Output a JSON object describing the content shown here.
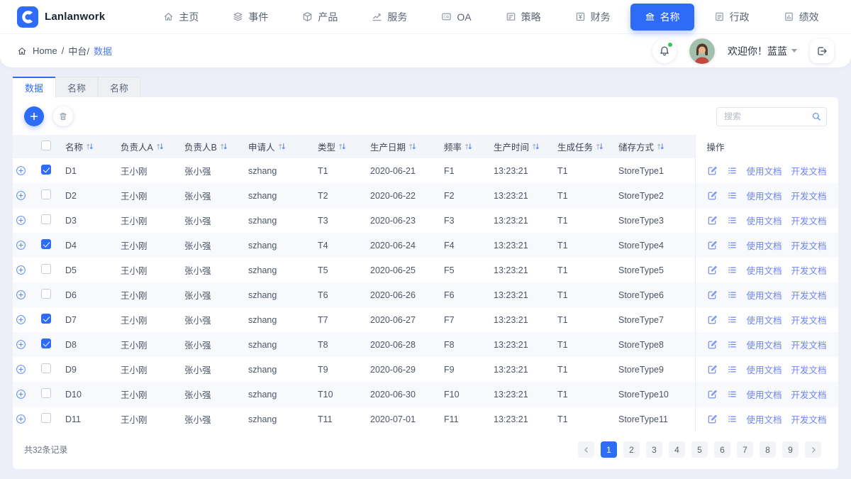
{
  "brand": {
    "name": "Lanlanwork",
    "logo_icon": "brand-c-icon",
    "logo_color": "#2e6bf6"
  },
  "nav": {
    "items": [
      {
        "label": "主页",
        "icon": "home-icon",
        "active": false
      },
      {
        "label": "事件",
        "icon": "event-icon",
        "active": false
      },
      {
        "label": "产品",
        "icon": "product-icon",
        "active": false
      },
      {
        "label": "服务",
        "icon": "service-icon",
        "active": false
      },
      {
        "label": "OA",
        "icon": "oa-icon",
        "active": false
      },
      {
        "label": "策略",
        "icon": "strategy-icon",
        "active": false
      },
      {
        "label": "财务",
        "icon": "finance-icon",
        "active": false
      },
      {
        "label": "名称",
        "icon": "bank-icon",
        "active": true
      },
      {
        "label": "行政",
        "icon": "admin-icon",
        "active": false
      },
      {
        "label": "绩效",
        "icon": "performance-icon",
        "active": false
      }
    ],
    "active_color": "#2e6bf6"
  },
  "breadcrumb": {
    "home": "Home",
    "sep": "/",
    "section": "中台/",
    "current": "数据"
  },
  "userbar": {
    "welcome": "欢迎你！蓝蓝",
    "bell_icon": "bell-icon",
    "logout_icon": "logout-icon",
    "notification_dot_color": "#35c759"
  },
  "tabs": [
    {
      "label": "数据",
      "active": true
    },
    {
      "label": "名称",
      "active": false
    },
    {
      "label": "名称",
      "active": false
    }
  ],
  "toolbar": {
    "add_icon": "plus-icon",
    "delete_icon": "trash-icon",
    "search_placeholder": "搜索",
    "search_icon": "search-icon"
  },
  "table": {
    "columns": [
      {
        "label": "名称",
        "sortable": true
      },
      {
        "label": "负责人A",
        "sortable": true
      },
      {
        "label": "负责人B",
        "sortable": true
      },
      {
        "label": "申请人",
        "sortable": true
      },
      {
        "label": "类型",
        "sortable": true
      },
      {
        "label": "生产日期",
        "sortable": true
      },
      {
        "label": "频率",
        "sortable": true
      },
      {
        "label": "生产时间",
        "sortable": true
      },
      {
        "label": "生成任务",
        "sortable": true
      },
      {
        "label": "储存方式",
        "sortable": true
      }
    ],
    "action_col_label": "操作",
    "row_action_icons": [
      "edit-icon",
      "list-icon"
    ],
    "row_action_links": [
      "使用文档",
      "开发文档"
    ],
    "rows": [
      {
        "checked": true,
        "name": "D1",
        "ownerA": "王小刚",
        "ownerB": "张小强",
        "applicant": "szhang",
        "type": "T1",
        "date": "2020-06-21",
        "freq": "F1",
        "time": "13:23:21",
        "task": "T1",
        "store": "StoreType1"
      },
      {
        "checked": false,
        "name": "D2",
        "ownerA": "王小刚",
        "ownerB": "张小强",
        "applicant": "szhang",
        "type": "T2",
        "date": "2020-06-22",
        "freq": "F2",
        "time": "13:23:21",
        "task": "T1",
        "store": "StoreType2"
      },
      {
        "checked": false,
        "name": "D3",
        "ownerA": "王小刚",
        "ownerB": "张小强",
        "applicant": "szhang",
        "type": "T3",
        "date": "2020-06-23",
        "freq": "F3",
        "time": "13:23:21",
        "task": "T1",
        "store": "StoreType3"
      },
      {
        "checked": true,
        "name": "D4",
        "ownerA": "王小刚",
        "ownerB": "张小强",
        "applicant": "szhang",
        "type": "T4",
        "date": "2020-06-24",
        "freq": "F4",
        "time": "13:23:21",
        "task": "T1",
        "store": "StoreType4"
      },
      {
        "checked": false,
        "name": "D5",
        "ownerA": "王小刚",
        "ownerB": "张小强",
        "applicant": "szhang",
        "type": "T5",
        "date": "2020-06-25",
        "freq": "F5",
        "time": "13:23:21",
        "task": "T1",
        "store": "StoreType5"
      },
      {
        "checked": false,
        "name": "D6",
        "ownerA": "王小刚",
        "ownerB": "张小强",
        "applicant": "szhang",
        "type": "T6",
        "date": "2020-06-26",
        "freq": "F6",
        "time": "13:23:21",
        "task": "T1",
        "store": "StoreType6"
      },
      {
        "checked": true,
        "name": "D7",
        "ownerA": "王小刚",
        "ownerB": "张小强",
        "applicant": "szhang",
        "type": "T7",
        "date": "2020-06-27",
        "freq": "F7",
        "time": "13:23:21",
        "task": "T1",
        "store": "StoreType7"
      },
      {
        "checked": true,
        "name": "D8",
        "ownerA": "王小刚",
        "ownerB": "张小强",
        "applicant": "szhang",
        "type": "T8",
        "date": "2020-06-28",
        "freq": "F8",
        "time": "13:23:21",
        "task": "T1",
        "store": "StoreType8"
      },
      {
        "checked": false,
        "name": "D9",
        "ownerA": "王小刚",
        "ownerB": "张小强",
        "applicant": "szhang",
        "type": "T9",
        "date": "2020-06-29",
        "freq": "F9",
        "time": "13:23:21",
        "task": "T1",
        "store": "StoreType9"
      },
      {
        "checked": false,
        "name": "D10",
        "ownerA": "王小刚",
        "ownerB": "张小强",
        "applicant": "szhang",
        "type": "T10",
        "date": "2020-06-30",
        "freq": "F10",
        "time": "13:23:21",
        "task": "T1",
        "store": "StoreType10"
      },
      {
        "checked": false,
        "name": "D11",
        "ownerA": "王小刚",
        "ownerB": "张小强",
        "applicant": "szhang",
        "type": "T11",
        "date": "2020-07-01",
        "freq": "F11",
        "time": "13:23:21",
        "task": "T1",
        "store": "StoreType11"
      }
    ]
  },
  "footer": {
    "total": "共32条记录",
    "pages": [
      "1",
      "2",
      "3",
      "4",
      "5",
      "6",
      "7",
      "8",
      "9"
    ],
    "active_page": "1"
  }
}
